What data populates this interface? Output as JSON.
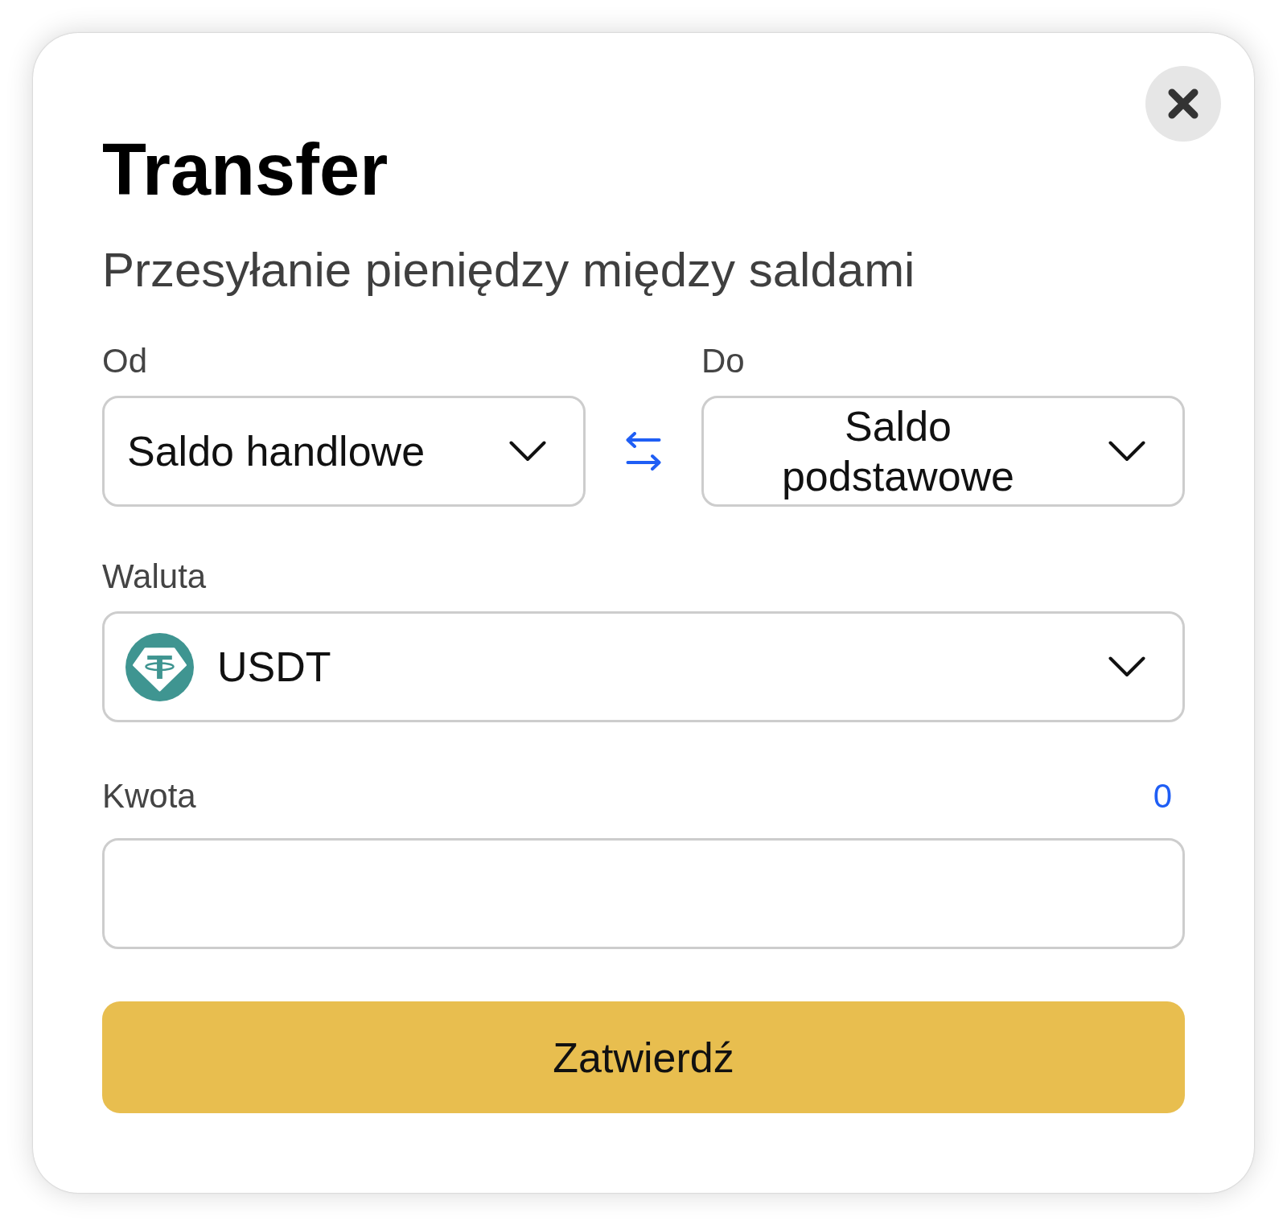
{
  "dialog": {
    "title": "Transfer",
    "subtitle": "Przesyłanie pieniędzy między saldami"
  },
  "from": {
    "label": "Od",
    "value": "Saldo handlowe"
  },
  "to": {
    "label": "Do",
    "value": "Saldo podstawowe"
  },
  "currency": {
    "label": "Waluta",
    "value": "USDT"
  },
  "amount": {
    "label": "Kwota",
    "balance": "0"
  },
  "submit_button": {
    "label": "Zatwierdź"
  }
}
